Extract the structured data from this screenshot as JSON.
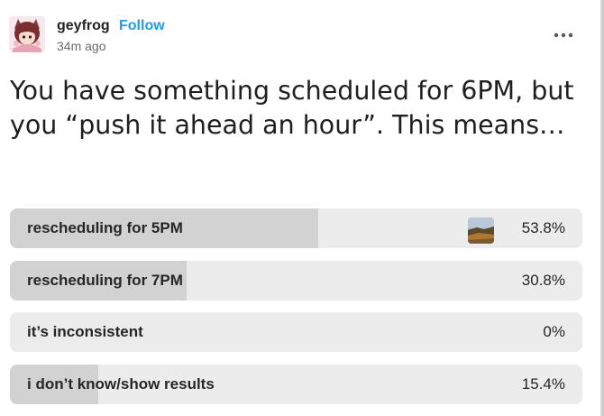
{
  "post": {
    "author": "geyfrog",
    "follow_label": "Follow",
    "time_ago": "34m ago",
    "more_icon": "more-horizontal-icon"
  },
  "poll": {
    "question": "You have something scheduled for 6PM, but you “push it ahead an hour”. This means…",
    "options": [
      {
        "label": "rescheduling for 5PM",
        "percent_text": "53.8%",
        "fraction": 0.538,
        "voted": true
      },
      {
        "label": "rescheduling for 7PM",
        "percent_text": "30.8%",
        "fraction": 0.308,
        "voted": false
      },
      {
        "label": "it’s inconsistent",
        "percent_text": "0%",
        "fraction": 0.0,
        "voted": false
      },
      {
        "label": "i don’t know/show results",
        "percent_text": "15.4%",
        "fraction": 0.154,
        "voted": false
      }
    ]
  },
  "colors": {
    "follow": "#1e9ce6",
    "option_bg": "#ececec",
    "option_fill": "#d2d2d2"
  }
}
